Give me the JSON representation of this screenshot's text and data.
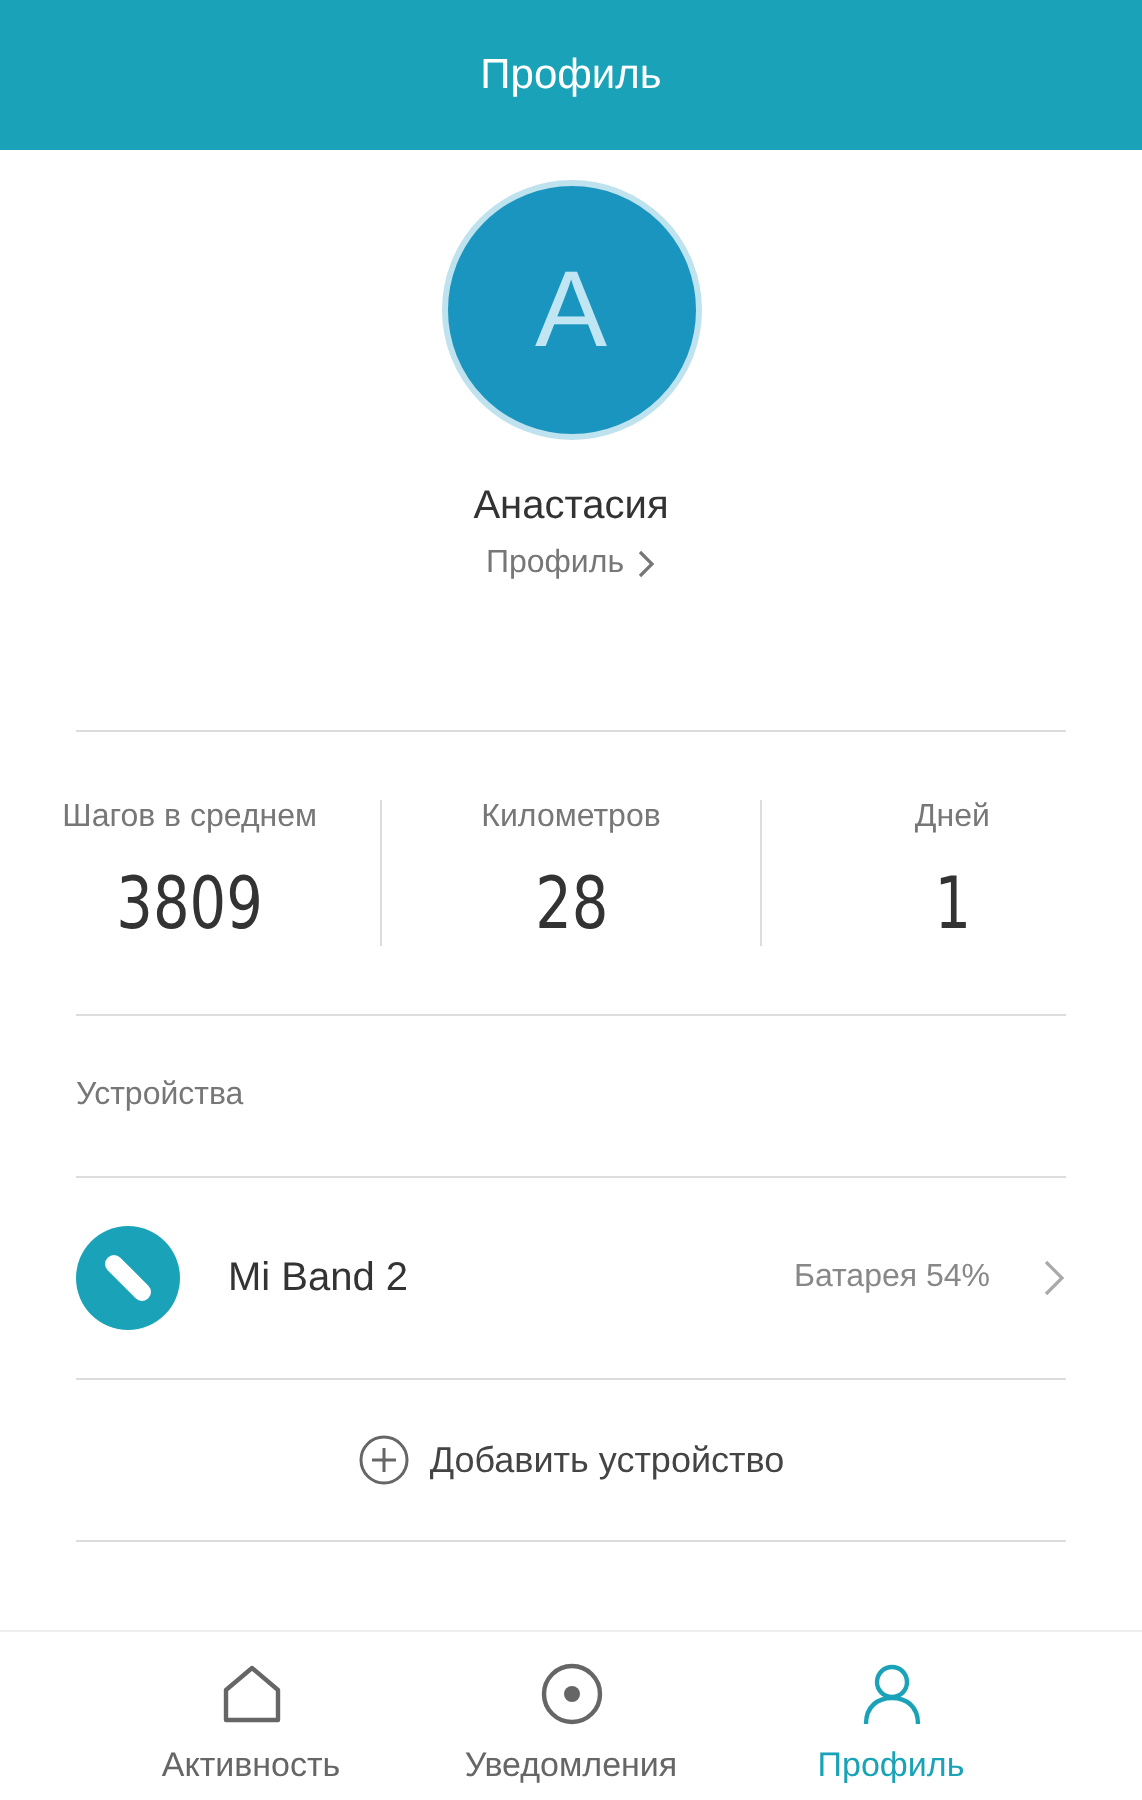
{
  "header": {
    "title": "Профиль"
  },
  "profile": {
    "avatar_letter": "A",
    "name": "Анастасия",
    "link": "Профиль"
  },
  "stats": [
    {
      "label": "Шагов в среднем",
      "value": "3809"
    },
    {
      "label": "Километров",
      "value": "28"
    },
    {
      "label": "Дней",
      "value": "1"
    }
  ],
  "devices": {
    "heading": "Устройства",
    "items": [
      {
        "name": "Mi Band 2",
        "battery": "Батарея 54%"
      }
    ],
    "add_label": "Добавить устройство"
  },
  "nav": [
    {
      "kind": "home",
      "label": "Активность",
      "selected": false
    },
    {
      "kind": "notifications",
      "label": "Уведомления",
      "selected": false
    },
    {
      "kind": "person",
      "label": "Профиль",
      "selected": true
    }
  ]
}
